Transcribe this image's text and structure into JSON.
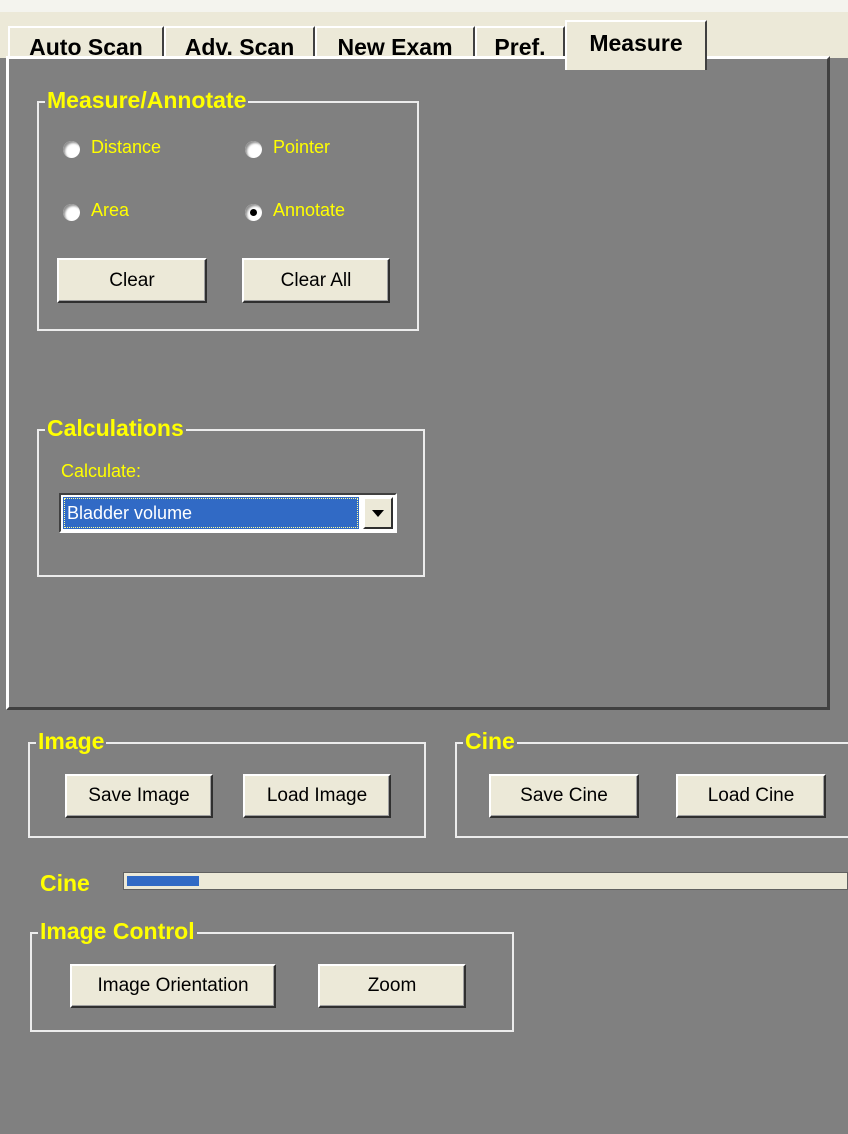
{
  "tabs": [
    {
      "label": "Auto Scan"
    },
    {
      "label": "Adv. Scan"
    },
    {
      "label": "New Exam"
    },
    {
      "label": "Pref."
    },
    {
      "label": "Measure",
      "active": true
    }
  ],
  "measure_group": {
    "title": "Measure/Annotate",
    "options": [
      {
        "label": "Distance",
        "selected": false
      },
      {
        "label": "Pointer",
        "selected": false
      },
      {
        "label": "Area",
        "selected": false
      },
      {
        "label": "Annotate",
        "selected": true
      }
    ],
    "clear_label": "Clear",
    "clear_all_label": "Clear All"
  },
  "calc_group": {
    "title": "Calculations",
    "calculate_label": "Calculate:",
    "selected": "Bladder volume"
  },
  "image_group": {
    "title": "Image",
    "save_label": "Save Image",
    "load_label": "Load Image"
  },
  "cine_group": {
    "title": "Cine",
    "save_label": "Save Cine",
    "load_label": "Load Cine"
  },
  "cine_slider": {
    "label": "Cine",
    "progress_percent": 10
  },
  "image_control_group": {
    "title": "Image Control",
    "orientation_label": "Image Orientation",
    "zoom_label": "Zoom"
  },
  "colors": {
    "background": "#808080",
    "label_yellow": "#ffff00",
    "selection_blue": "#316ac5",
    "button_face": "#ece9d8"
  }
}
